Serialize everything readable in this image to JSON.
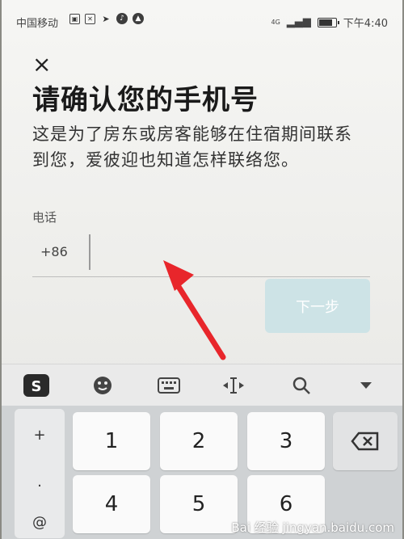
{
  "status_bar": {
    "carrier": "中国移动",
    "network": "4G",
    "time": "下午4:40",
    "icons": [
      "image-icon",
      "close-box-icon",
      "send-icon",
      "tiktok-icon",
      "alert-icon"
    ]
  },
  "dialog": {
    "close_label": "×",
    "title": "请确认您的手机号",
    "subtitle": "这是为了房东或房客能够在住宿期间联系到您，爱彼迎也知道怎样联络您。"
  },
  "phone": {
    "label": "电话",
    "country_code": "+86",
    "value": "",
    "placeholder": ""
  },
  "next_button": {
    "label": "下一步",
    "color": "#cde3e6"
  },
  "keyboard": {
    "toolbar": [
      "sogou-logo-icon",
      "emoji-icon",
      "keyboard-icon",
      "cursor-icon",
      "search-icon",
      "collapse-icon"
    ],
    "side_keys": [
      "+",
      ".",
      "@"
    ],
    "keys": [
      "1",
      "2",
      "3",
      "4",
      "5",
      "6"
    ],
    "backspace_icon": "backspace-icon"
  },
  "watermark": "Bai 经验 jingyan.baidu.com",
  "colors": {
    "arrow": "#e8262b"
  }
}
